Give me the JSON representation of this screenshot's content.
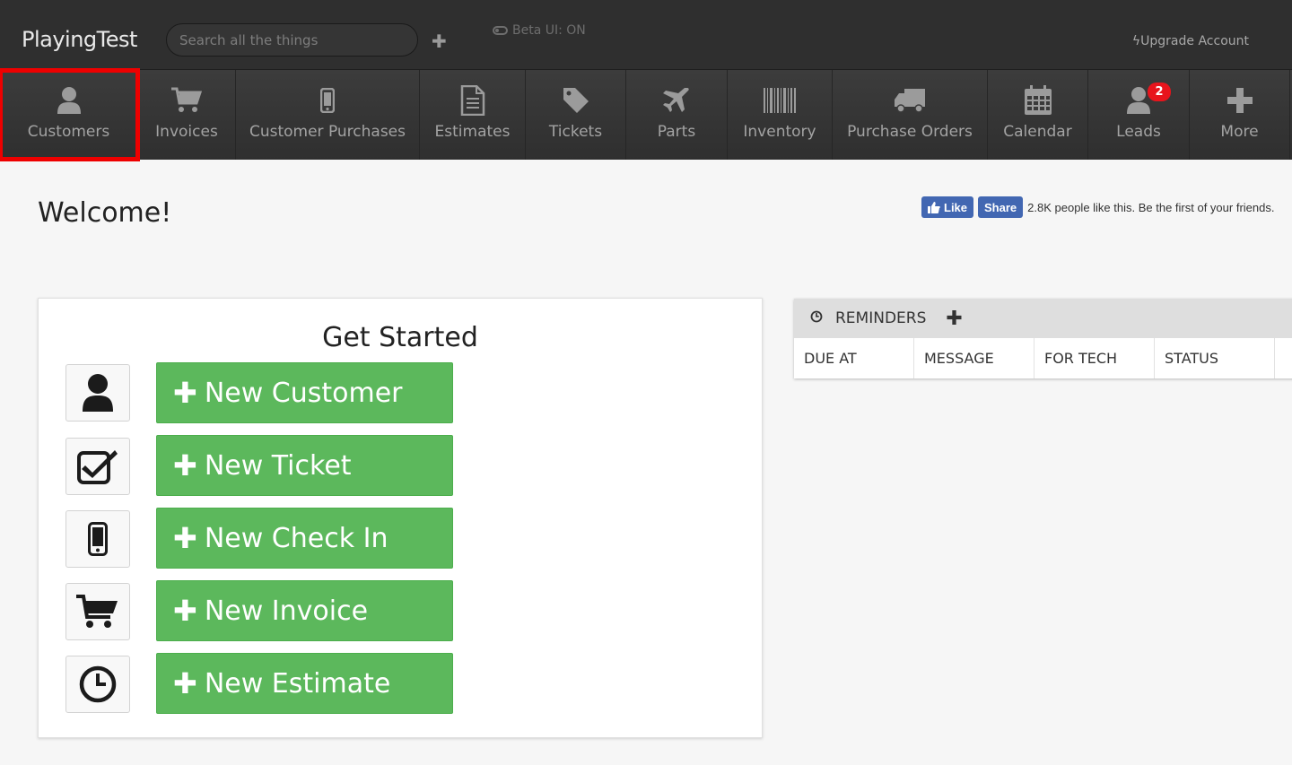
{
  "app": {
    "brand": "PlayingTest"
  },
  "topbar": {
    "search_placeholder": "Search all the things",
    "add_icon": "plus-icon",
    "beta_label": "Beta UI: ON",
    "upgrade_label": "Upgrade Account"
  },
  "nav": {
    "items": [
      {
        "label": "Customers",
        "icon": "user-icon",
        "active": true
      },
      {
        "label": "Invoices",
        "icon": "cart-icon"
      },
      {
        "label": "Customer Purchases",
        "icon": "mobile-icon"
      },
      {
        "label": "Estimates",
        "icon": "document-icon"
      },
      {
        "label": "Tickets",
        "icon": "tag-icon"
      },
      {
        "label": "Parts",
        "icon": "plane-icon"
      },
      {
        "label": "Inventory",
        "icon": "barcode-icon"
      },
      {
        "label": "Purchase Orders",
        "icon": "truck-icon"
      },
      {
        "label": "Calendar",
        "icon": "calendar-icon"
      },
      {
        "label": "Leads",
        "icon": "user-icon",
        "badge": "2"
      },
      {
        "label": "More",
        "icon": "plus-icon"
      }
    ]
  },
  "main": {
    "welcome": "Welcome!",
    "facebook": {
      "like_label": "Like",
      "share_label": "Share",
      "text": "2.8K people like this. Be the first of your friends."
    },
    "get_started": {
      "title": "Get Started",
      "rows": [
        {
          "icon": "user-icon",
          "label": "New Customer"
        },
        {
          "icon": "checkbox-icon",
          "label": "New Ticket"
        },
        {
          "icon": "mobile-icon",
          "label": "New Check In"
        },
        {
          "icon": "cart-icon",
          "label": "New Invoice"
        },
        {
          "icon": "clock-icon",
          "label": "New Estimate"
        }
      ]
    },
    "reminders": {
      "title": "REMINDERS",
      "columns": [
        "DUE AT",
        "MESSAGE",
        "FOR TECH",
        "STATUS"
      ]
    }
  },
  "colors": {
    "topbar_bg": "#2f2f2f",
    "button_green": "#5cb85c",
    "highlight_red": "#ee0000",
    "badge_red": "#e8141c",
    "facebook_blue": "#4267b2"
  }
}
